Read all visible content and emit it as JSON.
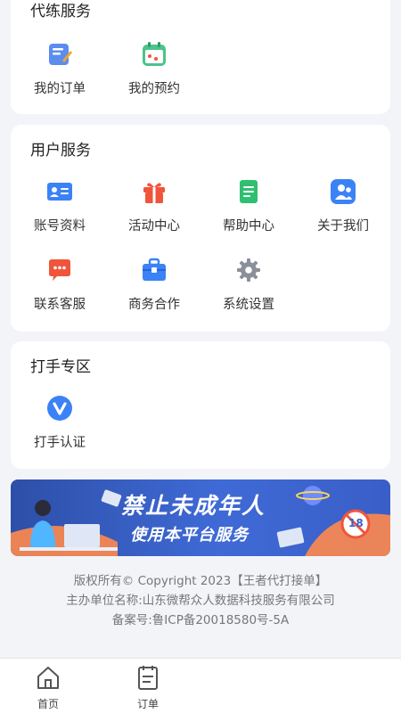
{
  "sections": {
    "training": {
      "title": "代练服务",
      "items": [
        {
          "label": "我的订单",
          "icon": "order-icon"
        },
        {
          "label": "我的预约",
          "icon": "calendar-icon"
        }
      ]
    },
    "user": {
      "title": "用户服务",
      "items": [
        {
          "label": "账号资料",
          "icon": "id-card-icon"
        },
        {
          "label": "活动中心",
          "icon": "gift-icon"
        },
        {
          "label": "帮助中心",
          "icon": "document-icon"
        },
        {
          "label": "关于我们",
          "icon": "people-icon"
        },
        {
          "label": "联系客服",
          "icon": "chat-icon"
        },
        {
          "label": "商务合作",
          "icon": "briefcase-icon"
        },
        {
          "label": "系统设置",
          "icon": "gear-icon"
        }
      ]
    },
    "player": {
      "title": "打手专区",
      "items": [
        {
          "label": "打手认证",
          "icon": "verified-icon"
        }
      ]
    }
  },
  "banner": {
    "line1": "禁止未成年人",
    "line2": "使用本平台服务",
    "badge": "18"
  },
  "footer": {
    "copyright": "版权所有© Copyright 2023【王者代打接单】",
    "organizer": "主办单位名称:山东微帮众人数据科技服务有限公司",
    "icp": "备案号:鲁ICP备20018580号-5A"
  },
  "tabbar": {
    "home": "首页",
    "orders": "订单"
  },
  "colors": {
    "background": "#f3f4f8",
    "card": "#ffffff",
    "blue": "#3b82f6",
    "red": "#f0553c",
    "green": "#2fbf71"
  }
}
